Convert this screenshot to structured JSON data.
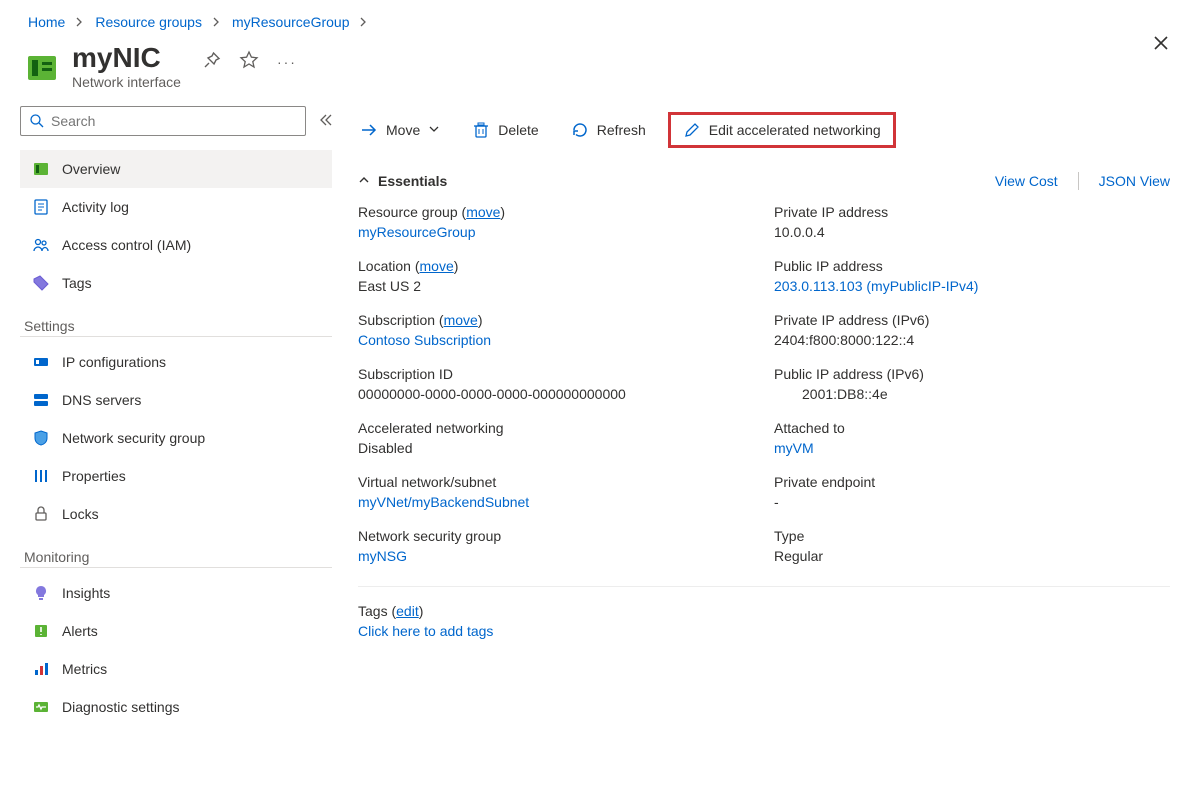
{
  "breadcrumbs": {
    "home": "Home",
    "rg_parent": "Resource groups",
    "rg": "myResourceGroup"
  },
  "header": {
    "title": "myNIC",
    "subtitle": "Network interface"
  },
  "search": {
    "placeholder": "Search"
  },
  "nav": {
    "overview": "Overview",
    "activity": "Activity log",
    "iam": "Access control (IAM)",
    "tags": "Tags",
    "section_settings": "Settings",
    "ipconf": "IP configurations",
    "dns": "DNS servers",
    "nsg": "Network security group",
    "props": "Properties",
    "locks": "Locks",
    "section_monitoring": "Monitoring",
    "insights": "Insights",
    "alerts": "Alerts",
    "metrics": "Metrics",
    "diag": "Diagnostic settings"
  },
  "toolbar": {
    "move": "Move",
    "delete": "Delete",
    "refresh": "Refresh",
    "edit_ean": "Edit accelerated networking"
  },
  "essentials": {
    "title": "Essentials",
    "view_cost": "View Cost",
    "json_view": "JSON View"
  },
  "left": {
    "rg_label": "Resource group",
    "rg_move": "move",
    "rg_value": "myResourceGroup",
    "loc_label": "Location",
    "loc_move": "move",
    "loc_value": "East US 2",
    "sub_label": "Subscription",
    "sub_move": "move",
    "sub_value": "Contoso Subscription",
    "subid_label": "Subscription ID",
    "subid_value": "00000000-0000-0000-0000-000000000000",
    "ean_label": "Accelerated networking",
    "ean_value": "Disabled",
    "vnet_label": "Virtual network/subnet",
    "vnet_value": "myVNet/myBackendSubnet",
    "nsg_label": "Network security group",
    "nsg_value": "myNSG"
  },
  "right": {
    "pip_label": "Private IP address",
    "pip_value": "10.0.0.4",
    "pub_label": "Public IP address",
    "pub_value": "203.0.113.103 (myPublicIP-IPv4)",
    "pip6_label": "Private IP address (IPv6)",
    "pip6_value": "2404:f800:8000:122::4",
    "pub6_label": "Public IP address (IPv6)",
    "pub6_value": "2001:DB8::4e",
    "att_label": "Attached to",
    "att_value": "myVM",
    "pep_label": "Private endpoint",
    "pep_value": "-",
    "type_label": "Type",
    "type_value": "Regular"
  },
  "tags": {
    "label": "Tags",
    "edit": "edit",
    "cta": "Click here to add tags"
  }
}
